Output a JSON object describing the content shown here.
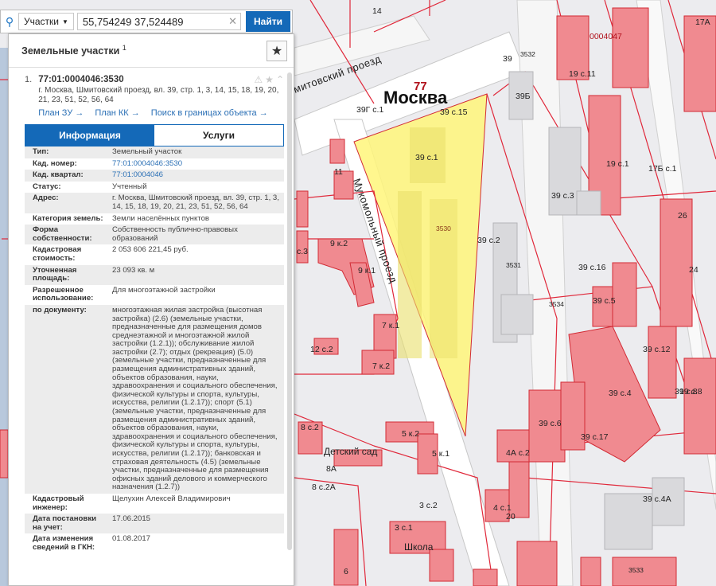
{
  "search": {
    "type_label": "Участки",
    "query": "55,754249 37,524489",
    "button_label": "Найти"
  },
  "panel": {
    "title": "Земельные участки",
    "title_sup": "1"
  },
  "result": {
    "number": "1.",
    "id": "77:01:0004046:3530",
    "address": "г. Москва, Шмитовский проезд, вл. 39, стр. 1, 3, 14, 15, 18, 19, 20, 21, 23, 51, 52, 56, 64",
    "links": [
      "План ЗУ →",
      "План КК →",
      "Поиск в границах объекта →"
    ]
  },
  "tabs": [
    "Информация",
    "Услуги"
  ],
  "info_rows": [
    {
      "label": "Тип:",
      "value": "Земельный участок",
      "link": false
    },
    {
      "label": "Кад. номер:",
      "value": "77:01:0004046:3530",
      "link": true
    },
    {
      "label": "Кад. квартал:",
      "value": "77:01:0004046",
      "link": true
    },
    {
      "label": "Статус:",
      "value": "Учтенный",
      "link": false
    },
    {
      "label": "Адрес:",
      "value": "г. Москва, Шмитовский проезд, вл. 39, стр. 1, 3, 14, 15, 18, 19, 20, 21, 23, 51, 52, 56, 64",
      "link": false
    },
    {
      "label": "Категория земель:",
      "value": "Земли населённых пунктов",
      "link": false
    },
    {
      "label": "Форма собственности:",
      "value": "Собственность публично-правовых образований",
      "link": false
    },
    {
      "label": "Кадастровая стоимость:",
      "value": "2 053 606 221,45 руб.",
      "link": false
    },
    {
      "label": "Уточненная площадь:",
      "value": "23 093 кв. м",
      "link": false
    },
    {
      "label": "Разрешенное использование:",
      "value": "Для многоэтажной застройки",
      "link": false
    },
    {
      "label": "по документу:",
      "value": "многоэтажная жилая застройка (высотная застройка) (2.6) (земельные участки, предназначенные для размещения домов среднеэтажной и многоэтажной жилой застройки (1.2.1)); обслуживание жилой застройки (2.7); отдых (рекреация) (5.0) (земельные участки, предназначенные для размещения административных зданий, объектов образования, науки, здравоохранения и социального обеспечения, физической культуры и спорта, культуры, искусства, религии (1.2.17)); спорт (5.1) (земельные участки, предназначенные для размещения административных зданий, объектов образования, науки, здравоохранения и социального обеспечения, физической культуры и спорта, культуры, искусства, религии (1.2.17)); банковская и страховая деятельность (4.5) (земельные участки, предназначенные для размещения офисных зданий делового и коммерческого назначения (1.2.7))",
      "link": false
    },
    {
      "label": "Кадастровый инженер:",
      "value": "Щелухин Алексей Владимирович",
      "link": false
    },
    {
      "label": "Дата постановки на учет:",
      "value": "17.06.2015",
      "link": false
    },
    {
      "label": "Дата изменения сведений в ГКН:",
      "value": "01.08.2017",
      "link": false
    }
  ],
  "map": {
    "city": "Москва",
    "region_code": "77",
    "streets": [
      "Шмитовский проезд",
      "Мукомольный проезд"
    ],
    "parcel_label": "3530",
    "labels": [
      "39 с.15",
      "39 с.1",
      "39 с.3",
      "39 с.2",
      "39 с.16",
      "39 с.5",
      "39 с.12",
      "39 с.4",
      "39 с.6",
      "39 с.17",
      "39 с.8",
      "39 с.4А",
      "19 с.11",
      "19 с.1",
      "19 с.8",
      "17Б с.1",
      "17А",
      "39Б",
      "39Г с.1",
      "39",
      "0004047",
      "14",
      "11",
      "9 к.2",
      "9 к.1",
      "с.3",
      "7 к.1",
      "7 к.2",
      "12 с.2",
      "8 с.2",
      "8А",
      "8 с.2А",
      "5 к.2",
      "5 к.1",
      "Детский сад",
      "3 с.2",
      "3 с.1",
      "Школа",
      "4А с.2",
      "4 с.1",
      "3532",
      "3531",
      "3534",
      "3533",
      "6",
      "26",
      "24",
      "20"
    ],
    "colors": {
      "building": "#f08a90",
      "building_stroke": "#d22b35",
      "parcel": "#fff67a",
      "road": "#ffffff",
      "water": "#b8c8dc"
    }
  }
}
